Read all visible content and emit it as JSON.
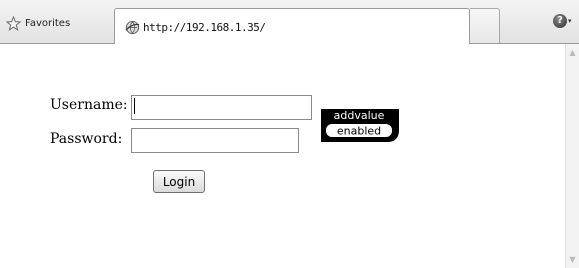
{
  "browser": {
    "favorites_label": "Favorites",
    "tab_label": "http://192.168.1.35/",
    "help_label": "?",
    "help_caret": "▾"
  },
  "login": {
    "username_label": "Username:",
    "username_value": "",
    "password_label": "Password:",
    "password_value": "",
    "login_button": "Login"
  },
  "logo": {
    "line1": "addvalue",
    "line2": "enabled"
  }
}
